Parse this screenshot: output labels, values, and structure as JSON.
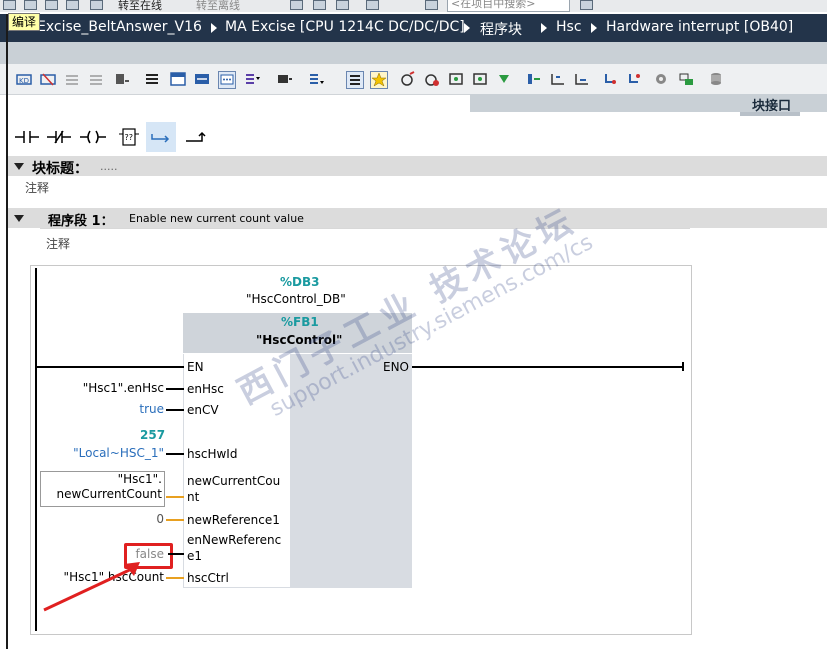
{
  "top_toolbar": {
    "go_online": "转至在线",
    "go_offline": "转至离线",
    "search_placeholder": "<在项目中搜索>"
  },
  "context_menu": {
    "label": "编译"
  },
  "breadcrumb": {
    "items": [
      "Excise_BeltAnswer_V16",
      "MA Excise [CPU 1214C DC/DC/DC]",
      "程序块",
      "Hsc",
      "Hardware interrupt [OB40]"
    ]
  },
  "right_pane": {
    "title": "块接口"
  },
  "block": {
    "title_label": "块标题：",
    "title_dots": ".....",
    "comment": "注释"
  },
  "network": {
    "label": "程序段 1：",
    "title": "Enable new current count value",
    "comment": "注释"
  },
  "fb_call": {
    "instance_db": "%DB3",
    "instance_db_symbol": "\"HscControl_DB\"",
    "fb_number": "%FB1",
    "fb_name": "\"HscControl\"",
    "eno": "ENO",
    "pins": [
      {
        "name": "EN",
        "actual": ""
      },
      {
        "name": "enHsc",
        "actual": "\"Hsc1\".enHsc"
      },
      {
        "name": "enCV",
        "actual": "true"
      },
      {
        "name": "hscHwId",
        "actual": "\"Local~HSC_1\"",
        "const": "257"
      },
      {
        "name": "newCurrentCou\nnt",
        "actual": "\"Hsc1\".\nnewCurrentCount"
      },
      {
        "name": "newReference1",
        "actual": "0"
      },
      {
        "name": "enNewReferenc\ne1",
        "actual": "false"
      },
      {
        "name": "hscCtrl",
        "actual": "\"Hsc1\".hscCount"
      }
    ]
  },
  "watermark": {
    "cn": "西门子工业  技术论坛",
    "url": "support.industry.siemens.com/cs"
  },
  "colors": {
    "header_bg": "#23344a",
    "teal": "#1a9aa0",
    "blue_actual": "#2a6ebb",
    "highlight": "#e02020",
    "wire_orange": "#e8a020"
  }
}
